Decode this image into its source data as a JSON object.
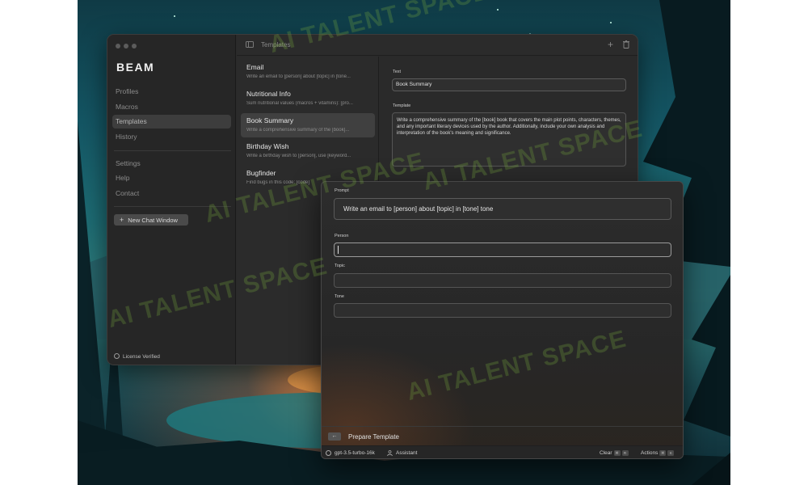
{
  "app": {
    "brand": "BEAM",
    "window_title": "Templates"
  },
  "sidebar": {
    "items": [
      {
        "label": "Profiles",
        "active": false
      },
      {
        "label": "Macros",
        "active": false
      },
      {
        "label": "Templates",
        "active": true
      },
      {
        "label": "History",
        "active": false
      }
    ],
    "secondary_items": [
      {
        "label": "Settings"
      },
      {
        "label": "Help"
      },
      {
        "label": "Contact"
      }
    ],
    "new_chat_label": "New Chat Window",
    "license_label": "License Verified"
  },
  "templates": [
    {
      "name": "Email",
      "desc": "Write an email to [person] about [topic] in [tone..."
    },
    {
      "name": "Nutritional Info",
      "desc": "Sum nutritional values (macros + vitamins): [pro..."
    },
    {
      "name": "Book Summary",
      "desc": "Write a comprehensive summary of the [book]...",
      "active": true
    },
    {
      "name": "Birthday Wish",
      "desc": "Write a birthday wish to [person], use [keyword..."
    },
    {
      "name": "Bugfinder",
      "desc": "Find bugs in this code: [code]"
    }
  ],
  "detail": {
    "text_label": "Text",
    "text_value": "Book Summary",
    "template_label": "Template",
    "template_value": "Write a comprehensive summary of the [book] book that covers the main plot points, characters, themes, and any important literary devices used by the author. Additionally, include your own analysis and interpretation of the book's meaning and significance."
  },
  "prompt_window": {
    "prompt_label": "Prompt",
    "prompt_value": "Write an email to [person] about [topic] in [tone] tone",
    "fields": [
      {
        "label": "Person",
        "value": "",
        "focused": true
      },
      {
        "label": "Topic",
        "value": ""
      },
      {
        "label": "Tone",
        "value": ""
      }
    ],
    "back_icon": "arrow-left-icon",
    "prepare_label": "Prepare Template",
    "status": {
      "model": "gpt-3.5-turbo-16k",
      "assistant": "Assistant",
      "clear_label": "Clear",
      "clear_keys": [
        "⌘",
        "R"
      ],
      "actions_label": "Actions",
      "actions_keys": [
        "⌘",
        "K"
      ]
    }
  },
  "watermark": "AI TALENT SPACE"
}
